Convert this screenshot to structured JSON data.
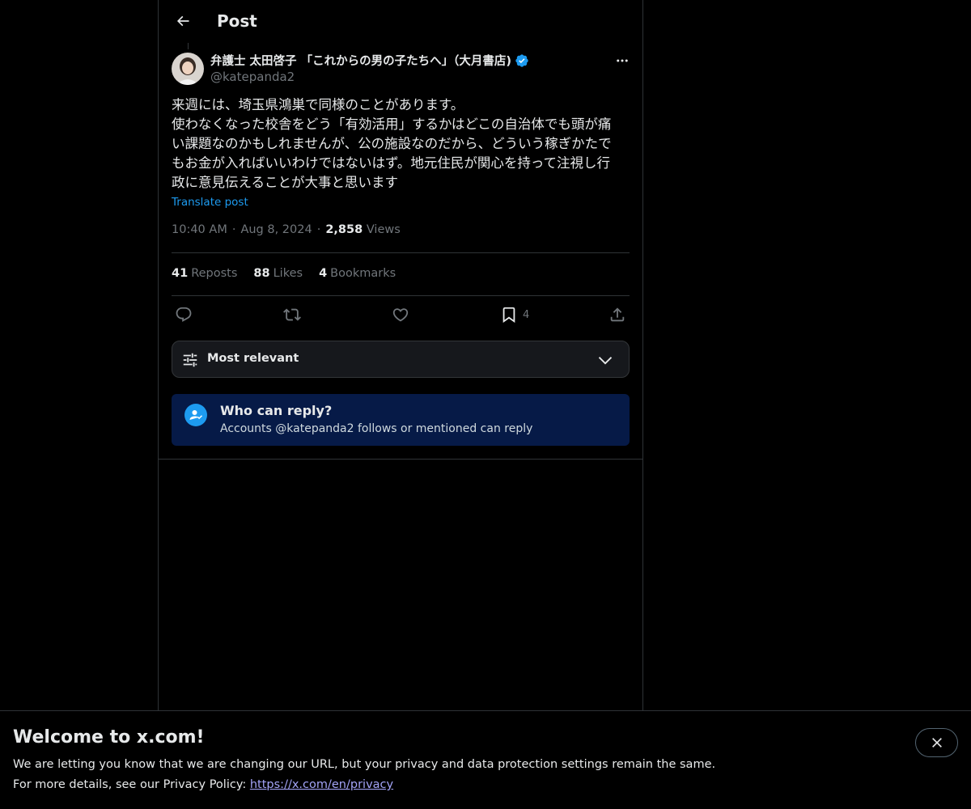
{
  "header": {
    "title": "Post"
  },
  "post": {
    "author_name": "弁護士 太田啓子 「これからの男の子たちへ」（大月書店)",
    "author_handle": "@katepanda2",
    "text_lines": [
      "来週には、埼玉県鴻巣で同様のことがあります。",
      "使わなくなった校舎をどう「有効活用」するかはどこの自治体でも頭が痛",
      "い課題なのかもしれませんが、公の施設なのだから、どういう稼ぎかたで",
      "もお金が入ればいいわけではないはず。地元住民が関心を持って注視し行",
      "政に意見伝えることが大事と思います"
    ],
    "translate_label": "Translate post",
    "time": "10:40 AM",
    "date": "Aug 8, 2024",
    "views_count": "2,858",
    "views_label": "Views",
    "separator": "·"
  },
  "stats": {
    "reposts_count": "41",
    "reposts_label": "Reposts",
    "likes_count": "88",
    "likes_label": "Likes",
    "bookmarks_count": "4",
    "bookmarks_label": "Bookmarks"
  },
  "actions": {
    "bookmark_count": "4",
    "icons": [
      "reply-icon",
      "repost-icon",
      "like-icon",
      "bookmark-icon",
      "share-icon"
    ]
  },
  "sort": {
    "label": "Most relevant"
  },
  "reply_restriction": {
    "title": "Who can reply?",
    "subtitle": "Accounts @katepanda2 follows or mentioned can reply"
  },
  "banner": {
    "title": "Welcome to x.com!",
    "line1": "We are letting you know that we are changing our URL, but your privacy and data protection settings remain the same.",
    "line2_prefix": "For more details, see our Privacy Policy: ",
    "link": "https://x.com/en/privacy"
  },
  "colors": {
    "background": "#000000",
    "accent": "#1d9bf0",
    "muted_text": "#71767b",
    "reply_box_bg": "#061a47",
    "link": "#a3a4f7"
  }
}
